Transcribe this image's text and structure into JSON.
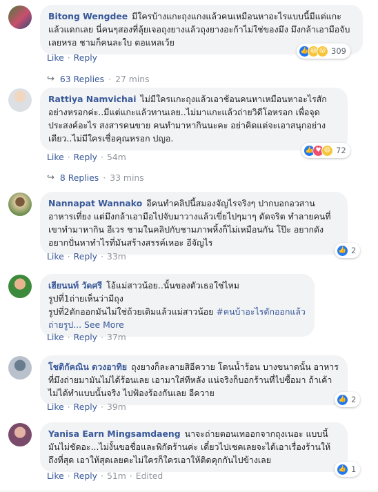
{
  "common": {
    "like": "Like",
    "reply": "Reply",
    "separator": "·",
    "see_more": "See More"
  },
  "comments": [
    {
      "author": "Bitong Wengdee",
      "text": "มีใครบ้างแกะถุงแกงแล้วคนเหมือนหาอะไรแบบนี้มีแต่แกะแล้วแดกเลย นี่คนๆสองที่ลุ้ยเจอถุงยางแล้วถุงยางอะก้าไม่ใช่ของมึง มึงกล้าเอามือจับเลยหรอ ชามก็คนละใบ ตอแหลเว้ย",
      "time": "",
      "reactions": [
        "like-icon",
        "haha-icon",
        "wow-icon"
      ],
      "reaction_count": "309",
      "replies_label": "63 Replies",
      "replies_time": "27 mins"
    },
    {
      "author": "Rattiya Namvichai",
      "text": "ไม่มีใครแกะถุงแล้วเอาช้อนคนหาเหมือนหาอะไรสักอย่างหรอกค่ะ..มีแต่แกะแล้วทานเลย..ไม่มาแกะแล้วถ่ายวิดีโอหรอก เพื่อจุดประสงค์อะไร สงสารคนขาย คนทำมาหากินนะคะ อย่าคิดแต่จะเอาสนุกอย่างเดียว..ไม่มีใครเชื่อคุณหรอก ปญอ.",
      "time": "54m",
      "reactions": [
        "like-icon",
        "love-icon",
        "haha-icon"
      ],
      "reaction_count": "72",
      "replies_label": "8 Replies",
      "replies_time": "33 mins"
    },
    {
      "author": "Nannapat Wannako",
      "text": "อีคนทำคลิปนี้สมองจัญไรจริงๆ ปากบอกอวสานอาหารเที่ยง แต่มึงกล้าเอามือไปจับมาวางแล้วเขี่ยไปๆมาๆ ดัดจริต ทำลายคนที่เขาทำมาหากิน อีเวร ชามในคลิปกับชามภาพหิ้งก็ไม่เหมือนกัน โป๊ะ อยากดังอยากปั่นหาทำไรที่มันสร้างสรรค์เหอะ อีจัญไร",
      "time": "33m",
      "reactions": [
        "like-icon"
      ],
      "reaction_count": "2"
    },
    {
      "author": "เฮียนนท์ วัดศรี",
      "text": "โอ้แม่สาวน้อย..นั้นของตัวเธอใช่ไหม",
      "text2": "รูปที่1ถ่ายเห็นว่ามีถุง",
      "text3": "รูปที่2ตักออกมันไม่ใช่ถ้วยเดิมแล้วแม่สาวน้อย ",
      "hashtag": "#คนบ้าอะไรตักออกแล้วถ่ายรูป...",
      "time": "37m"
    },
    {
      "author": "โชติกัคณิน ดวงอาทิย",
      "text": "ถุงยางก็ละลายสิอีควาย โดนน้ำร้อน บางขนาดนั้น อาหารที่มึงถ่ายมามันไม่ได้ร้อนเลย เอามาใส่ทีหลัง แน่จริงก็บอกร้านที่ไปซื้อมา ถ้าเค้าไม่ได้ทำแบบนั้นจริง ไปฟ้องร้องกันเลย อีควาย",
      "time": "39m",
      "reactions": [
        "like-icon"
      ],
      "reaction_count": "2"
    },
    {
      "author": "Yanisa Earn Mingsamdaeng",
      "text": "นาจะถ่ายตอนเทออกจากถุงเนอะ แบบนี้มันไม่ชัดอะ...ไม่งั้นขอชื่อและพิกัดร้านค่ะ เดี๋ยวไปเชคเลยจะได้เอาเรื่องร้านให้ถึงที่สุด เอาให้สุดเลยคะไม่ใครก็ใครเอาให้ติดคุกกันไปข้างเลย",
      "time": "51m",
      "edited": "Edited",
      "reactions": [
        "like-icon"
      ],
      "reaction_count": "1"
    }
  ],
  "colors": {
    "link": "#385898",
    "bubble": "#f2f3f5",
    "like": "#2078f4",
    "haha": "#f7c53a",
    "love": "#f0506e"
  }
}
